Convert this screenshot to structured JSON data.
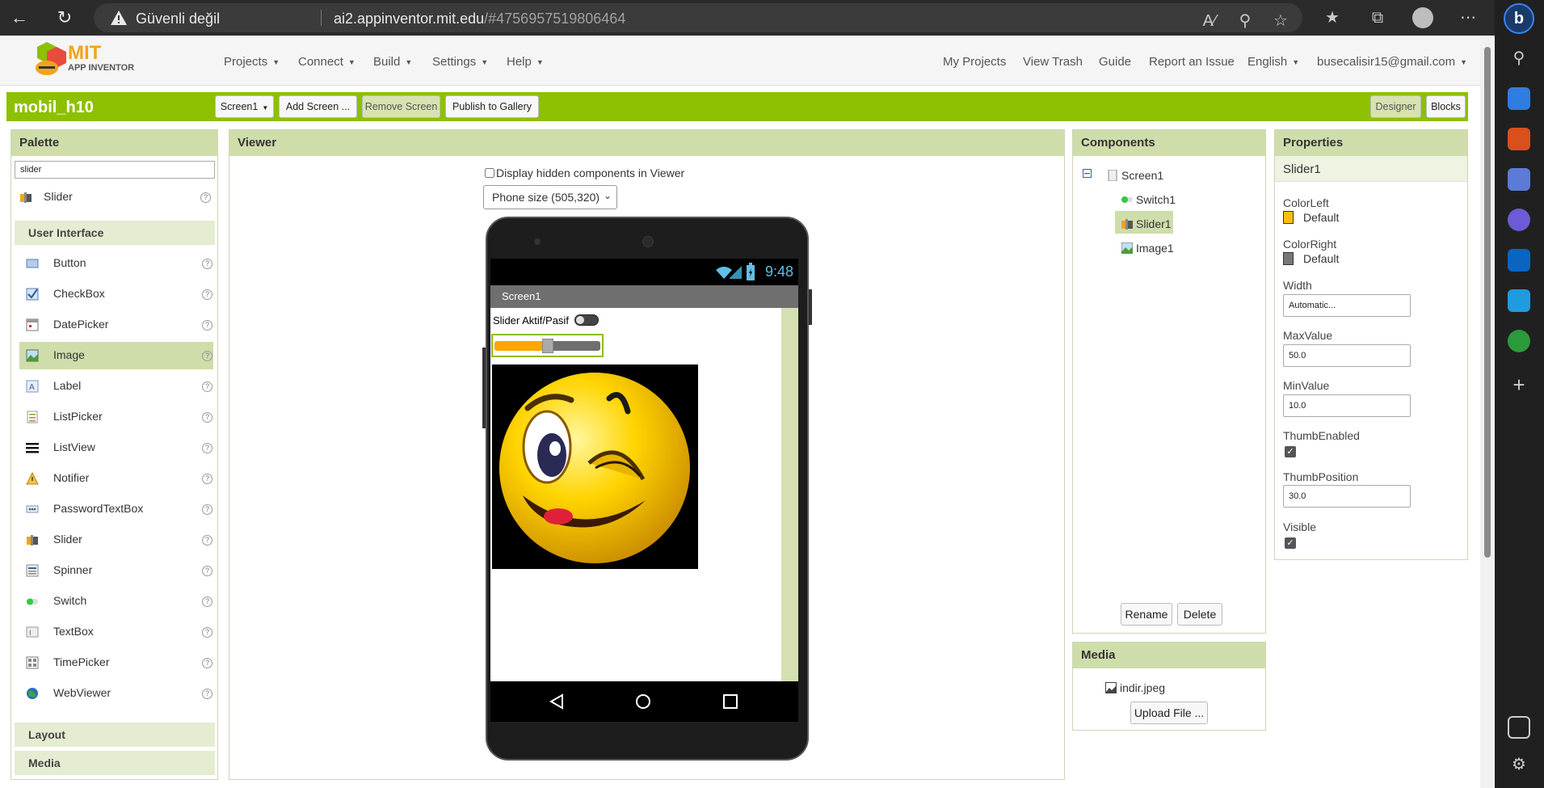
{
  "browser": {
    "insecure_label": "Güvenli değil",
    "url_host": "ai2.appinventor.mit.edu",
    "url_rest": "/#4756957519806464"
  },
  "app": {
    "logo_top": "MIT",
    "logo_bottom": "APP INVENTOR",
    "menu_left": [
      "Projects",
      "Connect",
      "Build",
      "Settings",
      "Help"
    ],
    "menu_right": {
      "my_projects": "My Projects",
      "view_trash": "View Trash",
      "guide": "Guide",
      "report": "Report an Issue",
      "language": "English",
      "account": "busecalisir15@gmail.com"
    }
  },
  "toolbar": {
    "project_name": "mobil_h10",
    "screen_select": "Screen1",
    "add_screen": "Add Screen ...",
    "remove_screen": "Remove Screen",
    "publish": "Publish to Gallery",
    "designer": "Designer",
    "blocks": "Blocks"
  },
  "palette": {
    "title": "Palette",
    "search_value": "slider",
    "search_result": "Slider",
    "category_ui": "User Interface",
    "items": [
      "Button",
      "CheckBox",
      "DatePicker",
      "Image",
      "Label",
      "ListPicker",
      "ListView",
      "Notifier",
      "PasswordTextBox",
      "Slider",
      "Spinner",
      "Switch",
      "TextBox",
      "TimePicker",
      "WebViewer"
    ],
    "selected_item": "Image",
    "category_layout": "Layout",
    "category_media": "Media",
    "help_glyph": "?"
  },
  "viewer": {
    "title": "Viewer",
    "hidden_checkbox_label": "Display hidden components in Viewer",
    "size_select": "Phone size (505,320)",
    "phone": {
      "time": "9:48",
      "screen_title": "Screen1",
      "switch_text": "Slider Aktif/Pasif",
      "slider": {
        "min": 10.0,
        "max": 50.0,
        "thumb": 30.0,
        "color_left": "#ffa500",
        "color_right": "#6f6f6f"
      }
    }
  },
  "components": {
    "title": "Components",
    "tree": {
      "root": "Screen1",
      "children": [
        "Switch1",
        "Slider1",
        "Image1"
      ],
      "selected": "Slider1"
    },
    "rename": "Rename",
    "delete": "Delete"
  },
  "media": {
    "title": "Media",
    "file": "indir.jpeg",
    "upload": "Upload File ..."
  },
  "properties": {
    "title": "Properties",
    "component": "Slider1",
    "color_left_label": "ColorLeft",
    "color_left_value": "Default",
    "color_left_swatch": "#ffc107",
    "color_right_label": "ColorRight",
    "color_right_value": "Default",
    "color_right_swatch": "#777777",
    "width_label": "Width",
    "width_value": "Automatic...",
    "max_label": "MaxValue",
    "max_value": "50.0",
    "min_label": "MinValue",
    "min_value": "10.0",
    "thumb_enabled_label": "ThumbEnabled",
    "thumb_enabled": true,
    "thumb_position_label": "ThumbPosition",
    "thumb_position_value": "30.0",
    "visible_label": "Visible",
    "visible": true
  },
  "colors": {
    "accent": "#8dc000",
    "panel_header": "#cfddab"
  }
}
